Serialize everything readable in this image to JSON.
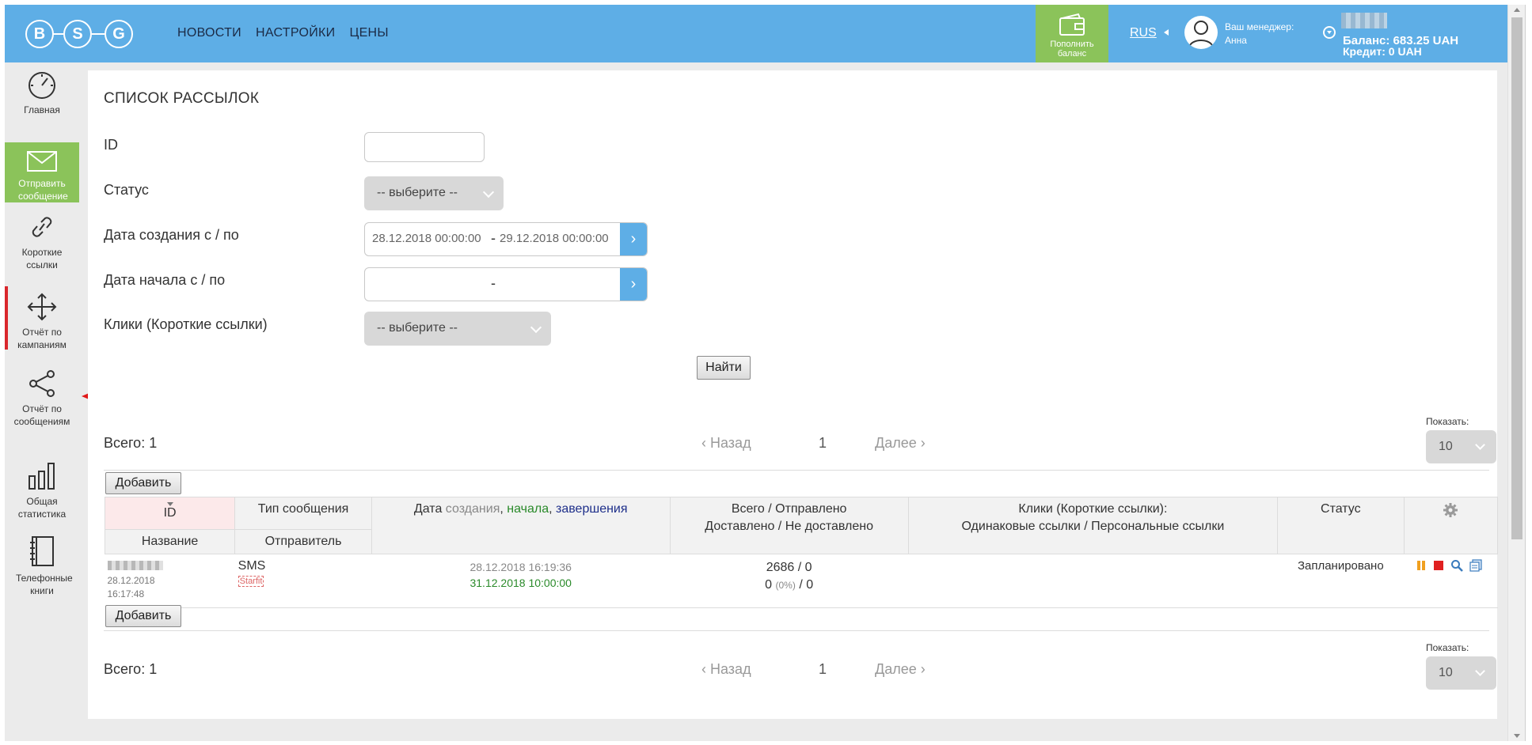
{
  "header": {
    "logo_letters": [
      "B",
      "S",
      "G"
    ],
    "nav": [
      "НОВОСТИ",
      "НАСТРОЙКИ",
      "ЦЕНЫ"
    ],
    "topup_label": "Пополнить баланс",
    "language": "RUS",
    "manager_label": "Ваш менеджер:",
    "manager_name": "Анна",
    "balance": "Баланс: 683.25 UAH",
    "credit": "Кредит: 0 UAH"
  },
  "sidebar": {
    "items": [
      {
        "label": "Главная",
        "icon": "speedometer-icon"
      },
      {
        "label": "Отправить сообщение",
        "icon": "envelope-icon"
      },
      {
        "label": "Короткие ссылки",
        "icon": "link-icon"
      },
      {
        "label": "Отчёт по кампаниям",
        "icon": "move-arrows-icon"
      },
      {
        "label": "Отчёт по сообщениям",
        "icon": "share-icon"
      },
      {
        "label": "Общая статистика",
        "icon": "bar-chart-icon"
      },
      {
        "label": "Телефонные книги",
        "icon": "notebook-icon"
      }
    ]
  },
  "page": {
    "title": "СПИСОК РАССЫЛОК"
  },
  "filters": {
    "id_label": "ID",
    "id_value": "",
    "status_label": "Статус",
    "status_value": "-- выберите --",
    "created_label": "Дата создания с / по",
    "created_from": "28.12.2018 00:00:00",
    "created_to": "29.12.2018 00:00:00",
    "created_sep": "-",
    "start_label": "Дата начала с / по",
    "start_sep": "-",
    "clicks_label": "Клики (Короткие ссылки)",
    "clicks_value": "-- выберите --",
    "find_button": "Найти"
  },
  "pagination": {
    "total": "Всего: 1",
    "prev": "Назад",
    "page": "1",
    "next": "Далее",
    "show_label": "Показать:",
    "show_value": "10"
  },
  "table": {
    "add_button": "Добавить",
    "headers": {
      "id": "ID",
      "name": "Название",
      "type": "Тип сообщения",
      "sender": "Отправитель",
      "date_prefix": "Дата",
      "date_created": "создания",
      "date_start": "начала",
      "date_end": "завершения",
      "totals_1": "Всего / Отправлено",
      "totals_2": "Доставлено / Не доставлено",
      "clicks_1": "Клики (Короткие ссылки):",
      "clicks_2": "Одинаковые ссылки / Персональные ссылки",
      "status": "Статус"
    },
    "rows": [
      {
        "date_line1": "28.12.2018",
        "date_line2": "16:17:48",
        "type": "SMS",
        "sender": "Starfit",
        "created": "28.12.2018 16:19:36",
        "start": "31.12.2018 10:00:00",
        "total_sent": "2686 / 0",
        "delivered_prefix": "0",
        "delivered_pct": "(0%)",
        "delivered_suffix": "/ 0",
        "status": "Запланировано"
      }
    ]
  },
  "colors": {
    "header_bg": "#5eaee6",
    "accent_green": "#8bc35a",
    "active_marker": "#d9262c"
  }
}
